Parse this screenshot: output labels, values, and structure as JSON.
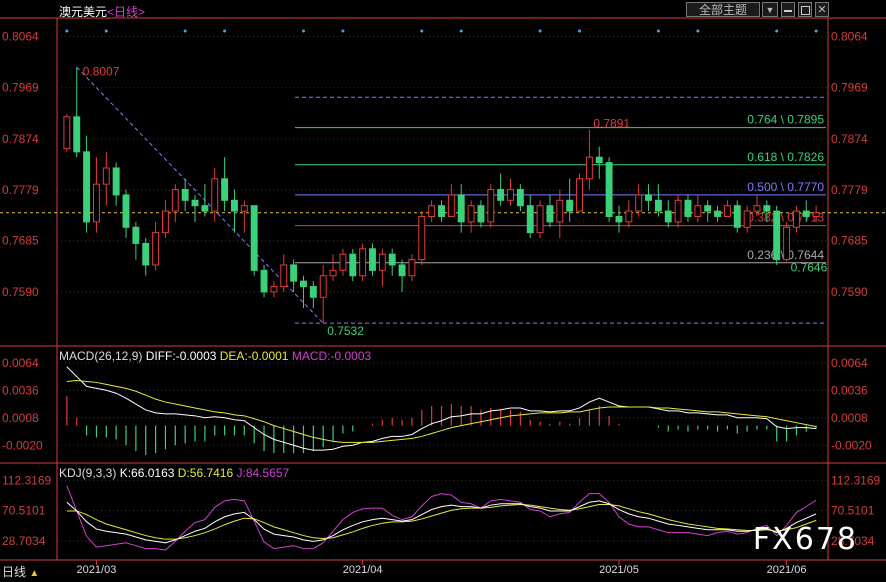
{
  "title": "澳元美元",
  "period_label": "<日线>",
  "header": {
    "theme_label": "全部主题",
    "dropdown_icon": "triangle-down-icon",
    "buttons": [
      "minimize-icon",
      "restore-icon",
      "close-icon"
    ]
  },
  "bottom_bar": {
    "period": "日线",
    "arrow_icon": "triangle-up-icon"
  },
  "watermark": "FX678",
  "colors": {
    "up": "#e23b3b",
    "down": "#3bd07a",
    "grid": "#7a1a1a",
    "axis": "#d33c3c",
    "dif": "#ffffff",
    "dea": "#e8e83a",
    "macd_label": "#d040d0",
    "k": "#ffffff",
    "d": "#e8e83a",
    "j": "#d040d0",
    "fib": "#7c7cff"
  },
  "chart_data": [
    {
      "type": "candlestick",
      "name": "main",
      "ylim": [
        0.7497,
        0.8091
      ],
      "yticks": [
        "0.8064",
        "0.7969",
        "0.7874",
        "0.7779",
        "0.7685",
        "0.7590"
      ],
      "xticks": [
        "2021/03",
        "2021/04",
        "2021/05",
        "2021/06"
      ],
      "current_price": 0.7737,
      "ohlc": [
        [
          0.7856,
          0.792,
          0.785,
          0.7915
        ],
        [
          0.7915,
          0.8007,
          0.784,
          0.785
        ],
        [
          0.785,
          0.788,
          0.77,
          0.772
        ],
        [
          0.772,
          0.784,
          0.77,
          0.779
        ],
        [
          0.779,
          0.785,
          0.775,
          0.782
        ],
        [
          0.782,
          0.783,
          0.775,
          0.777
        ],
        [
          0.777,
          0.778,
          0.769,
          0.771
        ],
        [
          0.771,
          0.772,
          0.765,
          0.768
        ],
        [
          0.768,
          0.769,
          0.762,
          0.764
        ],
        [
          0.764,
          0.772,
          0.763,
          0.77
        ],
        [
          0.77,
          0.776,
          0.769,
          0.774
        ],
        [
          0.774,
          0.779,
          0.772,
          0.778
        ],
        [
          0.778,
          0.78,
          0.774,
          0.776
        ],
        [
          0.776,
          0.777,
          0.772,
          0.775
        ],
        [
          0.775,
          0.779,
          0.773,
          0.774
        ],
        [
          0.774,
          0.782,
          0.772,
          0.78
        ],
        [
          0.78,
          0.784,
          0.774,
          0.776
        ],
        [
          0.776,
          0.778,
          0.77,
          0.774
        ],
        [
          0.774,
          0.776,
          0.77,
          0.775
        ],
        [
          0.775,
          0.775,
          0.762,
          0.763
        ],
        [
          0.763,
          0.764,
          0.758,
          0.759
        ],
        [
          0.759,
          0.761,
          0.758,
          0.76
        ],
        [
          0.76,
          0.766,
          0.759,
          0.764
        ],
        [
          0.764,
          0.765,
          0.759,
          0.761
        ],
        [
          0.761,
          0.762,
          0.756,
          0.76
        ],
        [
          0.76,
          0.761,
          0.756,
          0.758
        ],
        [
          0.758,
          0.764,
          0.7532,
          0.762
        ],
        [
          0.762,
          0.766,
          0.761,
          0.763
        ],
        [
          0.763,
          0.767,
          0.762,
          0.766
        ],
        [
          0.766,
          0.767,
          0.761,
          0.762
        ],
        [
          0.762,
          0.768,
          0.761,
          0.767
        ],
        [
          0.767,
          0.768,
          0.762,
          0.763
        ],
        [
          0.763,
          0.767,
          0.76,
          0.766
        ],
        [
          0.766,
          0.767,
          0.762,
          0.764
        ],
        [
          0.764,
          0.765,
          0.759,
          0.762
        ],
        [
          0.762,
          0.766,
          0.761,
          0.765
        ],
        [
          0.765,
          0.774,
          0.764,
          0.773
        ],
        [
          0.773,
          0.776,
          0.772,
          0.775
        ],
        [
          0.775,
          0.776,
          0.772,
          0.773
        ],
        [
          0.773,
          0.779,
          0.773,
          0.777
        ],
        [
          0.777,
          0.779,
          0.77,
          0.772
        ],
        [
          0.772,
          0.776,
          0.77,
          0.775
        ],
        [
          0.775,
          0.776,
          0.771,
          0.772
        ],
        [
          0.772,
          0.779,
          0.771,
          0.778
        ],
        [
          0.778,
          0.781,
          0.775,
          0.776
        ],
        [
          0.776,
          0.78,
          0.775,
          0.778
        ],
        [
          0.778,
          0.779,
          0.774,
          0.775
        ],
        [
          0.775,
          0.777,
          0.769,
          0.77
        ],
        [
          0.77,
          0.776,
          0.769,
          0.775
        ],
        [
          0.775,
          0.777,
          0.771,
          0.772
        ],
        [
          0.772,
          0.778,
          0.769,
          0.776
        ],
        [
          0.776,
          0.78,
          0.772,
          0.774
        ],
        [
          0.774,
          0.781,
          0.774,
          0.78
        ],
        [
          0.78,
          0.7891,
          0.778,
          0.784
        ],
        [
          0.784,
          0.786,
          0.78,
          0.783
        ],
        [
          0.783,
          0.784,
          0.772,
          0.773
        ],
        [
          0.773,
          0.775,
          0.77,
          0.772
        ],
        [
          0.772,
          0.776,
          0.771,
          0.774
        ],
        [
          0.774,
          0.779,
          0.773,
          0.777
        ],
        [
          0.777,
          0.779,
          0.774,
          0.776
        ],
        [
          0.776,
          0.779,
          0.773,
          0.774
        ],
        [
          0.774,
          0.776,
          0.771,
          0.772
        ],
        [
          0.772,
          0.777,
          0.771,
          0.776
        ],
        [
          0.776,
          0.777,
          0.772,
          0.773
        ],
        [
          0.773,
          0.777,
          0.772,
          0.775
        ],
        [
          0.775,
          0.776,
          0.772,
          0.774
        ],
        [
          0.774,
          0.775,
          0.772,
          0.773
        ],
        [
          0.773,
          0.776,
          0.773,
          0.775
        ],
        [
          0.775,
          0.776,
          0.77,
          0.771
        ],
        [
          0.771,
          0.775,
          0.77,
          0.774
        ],
        [
          0.774,
          0.777,
          0.773,
          0.775
        ],
        [
          0.775,
          0.776,
          0.772,
          0.774
        ],
        [
          0.774,
          0.775,
          0.764,
          0.765
        ],
        [
          0.765,
          0.772,
          0.7646,
          0.771
        ],
        [
          0.771,
          0.775,
          0.77,
          0.774
        ],
        [
          0.774,
          0.776,
          0.772,
          0.773
        ],
        [
          0.773,
          0.775,
          0.772,
          0.7737
        ]
      ],
      "annotations": [
        {
          "label": "0.8007",
          "value": 0.8007
        },
        {
          "label": "0.7532",
          "value": 0.7532
        },
        {
          "label": "0.7891",
          "value": 0.7891
        },
        {
          "label": "0.7646",
          "value": 0.7646
        }
      ],
      "fibonacci": [
        {
          "label": "0.764 \\ 0.7895",
          "value": 0.7895,
          "color": "#3bd07a"
        },
        {
          "label": "0.618 \\ 0.7826",
          "value": 0.7826,
          "color": "#3bd07a"
        },
        {
          "label": "0.500 \\ 0.7770",
          "value": 0.777,
          "color": "#7c7cff"
        },
        {
          "label": "0.382 \\ 0.7713",
          "value": 0.7713,
          "color": "#e23b3b"
        },
        {
          "label": "0.236 \\ 0.7644",
          "value": 0.7644,
          "color": "#aaaaaa"
        }
      ],
      "fib_bounds": [
        0.8007,
        0.7532
      ]
    },
    {
      "type": "macd",
      "name": "MACD",
      "label": "MACD(26,12,9)",
      "dif_label": "DIFF:-0.0003",
      "dea_label": "DEA:-0.0001",
      "macd_label": "MACD:-0.0003",
      "ylim": [
        -0.0035,
        0.0075
      ],
      "yticks": [
        "0.0064",
        "0.0036",
        "0.0008",
        "-0.0020"
      ],
      "dif": [
        0.006,
        0.005,
        0.004,
        0.0038,
        0.0036,
        0.0033,
        0.0028,
        0.0022,
        0.0016,
        0.0013,
        0.0012,
        0.0012,
        0.0011,
        0.001,
        0.0008,
        0.0009,
        0.0008,
        0.0006,
        0.0005,
        -0.0002,
        -0.0009,
        -0.0014,
        -0.0017,
        -0.002,
        -0.0023,
        -0.0025,
        -0.0025,
        -0.0024,
        -0.0021,
        -0.002,
        -0.0017,
        -0.0016,
        -0.0013,
        -0.0011,
        -0.0011,
        -0.0009,
        -0.0003,
        0.0002,
        0.0005,
        0.0009,
        0.001,
        0.0012,
        0.0012,
        0.0015,
        0.0016,
        0.0018,
        0.0018,
        0.0015,
        0.0015,
        0.0014,
        0.0015,
        0.0015,
        0.0018,
        0.0024,
        0.0028,
        0.0024,
        0.002,
        0.0019,
        0.0019,
        0.0019,
        0.0017,
        0.0015,
        0.0015,
        0.0013,
        0.0013,
        0.0012,
        0.0011,
        0.0011,
        0.0008,
        0.0008,
        0.0008,
        0.0007,
        -0.0001,
        -0.0003,
        -0.0002,
        -0.0002,
        -0.0003
      ],
      "dea": [
        0.0045,
        0.0046,
        0.0045,
        0.0044,
        0.0042,
        0.004,
        0.0038,
        0.0035,
        0.0031,
        0.0027,
        0.0024,
        0.0022,
        0.002,
        0.0018,
        0.0016,
        0.0014,
        0.0013,
        0.0011,
        0.001,
        0.0007,
        0.0004,
        0.0,
        -0.0003,
        -0.0006,
        -0.0009,
        -0.0012,
        -0.0014,
        -0.0016,
        -0.0017,
        -0.0017,
        -0.0017,
        -0.0017,
        -0.0016,
        -0.0015,
        -0.0014,
        -0.0013,
        -0.0011,
        -0.0008,
        -0.0005,
        -0.0002,
        0.0,
        0.0002,
        0.0004,
        0.0006,
        0.0008,
        0.001,
        0.0011,
        0.0012,
        0.0013,
        0.0013,
        0.0013,
        0.0014,
        0.0014,
        0.0016,
        0.0018,
        0.0019,
        0.0019,
        0.0019,
        0.0019,
        0.0019,
        0.0018,
        0.0018,
        0.0017,
        0.0016,
        0.0015,
        0.0014,
        0.0014,
        0.0013,
        0.0012,
        0.0011,
        0.001,
        0.0009,
        0.0007,
        0.0005,
        0.0003,
        0.0001,
        -0.0001
      ],
      "hist": [
        0.003,
        0.0008,
        -0.001,
        -0.0012,
        -0.0012,
        -0.0014,
        -0.002,
        -0.0026,
        -0.003,
        -0.0028,
        -0.0024,
        -0.002,
        -0.0018,
        -0.0016,
        -0.0016,
        -0.001,
        -0.001,
        -0.001,
        -0.001,
        -0.0018,
        -0.0026,
        -0.0028,
        -0.0028,
        -0.0028,
        -0.0028,
        -0.0026,
        -0.0022,
        -0.0016,
        -0.0008,
        -0.0006,
        0.0,
        0.0002,
        0.0006,
        0.0008,
        0.0006,
        0.0008,
        0.0016,
        0.002,
        0.002,
        0.0022,
        0.002,
        0.002,
        0.0016,
        0.0018,
        0.0016,
        0.0016,
        0.0014,
        0.0006,
        0.0004,
        0.0002,
        0.0004,
        0.0002,
        0.0008,
        0.0016,
        0.002,
        0.001,
        0.0002,
        0.0,
        0.0,
        0.0,
        -0.0002,
        -0.0006,
        -0.0004,
        -0.0006,
        -0.0004,
        -0.0004,
        -0.0006,
        -0.0004,
        -0.0008,
        -0.0006,
        -0.0004,
        -0.0004,
        -0.0016,
        -0.0016,
        -0.001,
        -0.0006,
        -0.0003
      ]
    },
    {
      "type": "kdj",
      "name": "KDJ",
      "label": "KDJ(9,3,3)",
      "k_label": "K:66.0163",
      "d_label": "D:56.7416",
      "j_label": "J:84.5657",
      "ylim": [
        5,
        128
      ],
      "yticks": [
        "112.3169",
        "70.5101",
        "28.7034"
      ],
      "k": [
        82,
        70,
        55,
        45,
        42,
        40,
        38,
        34,
        30,
        28,
        26,
        30,
        36,
        42,
        46,
        55,
        62,
        66,
        68,
        58,
        45,
        38,
        36,
        34,
        30,
        28,
        30,
        36,
        44,
        50,
        55,
        58,
        60,
        58,
        56,
        58,
        65,
        72,
        76,
        78,
        76,
        76,
        74,
        78,
        80,
        80,
        80,
        76,
        74,
        70,
        70,
        70,
        76,
        82,
        84,
        80,
        72,
        66,
        62,
        60,
        56,
        52,
        50,
        48,
        46,
        44,
        44,
        44,
        42,
        42,
        44,
        46,
        40,
        46,
        54,
        60,
        66
      ],
      "d": [
        70,
        70,
        65,
        58,
        52,
        48,
        44,
        40,
        36,
        33,
        31,
        31,
        33,
        36,
        40,
        45,
        51,
        56,
        60,
        59,
        54,
        48,
        44,
        40,
        36,
        33,
        32,
        33,
        37,
        41,
        46,
        50,
        53,
        55,
        55,
        56,
        59,
        63,
        67,
        71,
        73,
        74,
        74,
        75,
        77,
        78,
        79,
        78,
        76,
        74,
        72,
        71,
        73,
        76,
        79,
        79,
        77,
        73,
        69,
        66,
        62,
        58,
        55,
        52,
        50,
        48,
        46,
        45,
        44,
        43,
        43,
        44,
        42,
        44,
        47,
        52,
        57
      ],
      "j": [
        105,
        70,
        35,
        20,
        22,
        24,
        26,
        22,
        18,
        18,
        16,
        28,
        42,
        54,
        58,
        75,
        84,
        86,
        84,
        56,
        27,
        18,
        20,
        22,
        18,
        18,
        26,
        42,
        58,
        68,
        73,
        74,
        74,
        64,
        58,
        62,
        77,
        90,
        94,
        92,
        82,
        80,
        74,
        84,
        86,
        84,
        82,
        72,
        70,
        62,
        66,
        68,
        82,
        94,
        94,
        82,
        62,
        52,
        48,
        48,
        44,
        40,
        40,
        40,
        38,
        36,
        40,
        42,
        38,
        40,
        46,
        50,
        36,
        50,
        68,
        76,
        85
      ]
    }
  ]
}
